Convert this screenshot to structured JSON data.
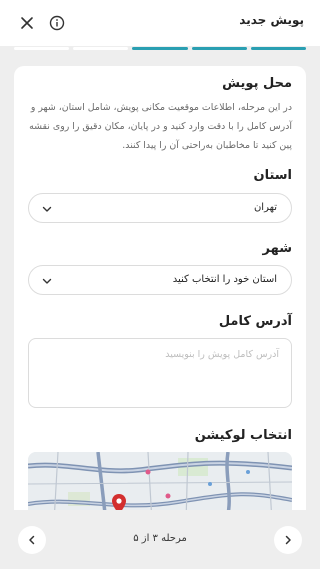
{
  "header": {
    "title": "پویش جدید",
    "close_icon": "close-icon",
    "info_icon": "info-icon"
  },
  "progress": {
    "total_steps": 5,
    "completed_steps": 3
  },
  "colors": {
    "accent": "#2a9fb2",
    "background": "#eeeeee",
    "card": "#ffffff",
    "map_pin": "#d32f2f"
  },
  "section": {
    "title": "محل پویش",
    "description": "در این مرحله، اطلاعات موقعیت مکانی پویش، شامل استان، شهر و آدرس کامل را با دقت وارد کنید و در پایان، مکان دقیق را روی نقشه پین کنید تا مخاطبان به‌راحتی آن را پیدا کنند."
  },
  "province": {
    "label": "استان",
    "value": "تهران"
  },
  "city": {
    "label": "شهر",
    "value": "استان خود را انتخاب کنید"
  },
  "address": {
    "label": "آدرس کامل",
    "placeholder": "آدرس کامل پویش را بنویسید"
  },
  "location": {
    "label": "انتخاب لوکیشن"
  },
  "footer": {
    "step_text": "مرحله ۳ از ۵",
    "prev_icon": "chevron-left-icon",
    "next_icon": "chevron-right-icon"
  }
}
